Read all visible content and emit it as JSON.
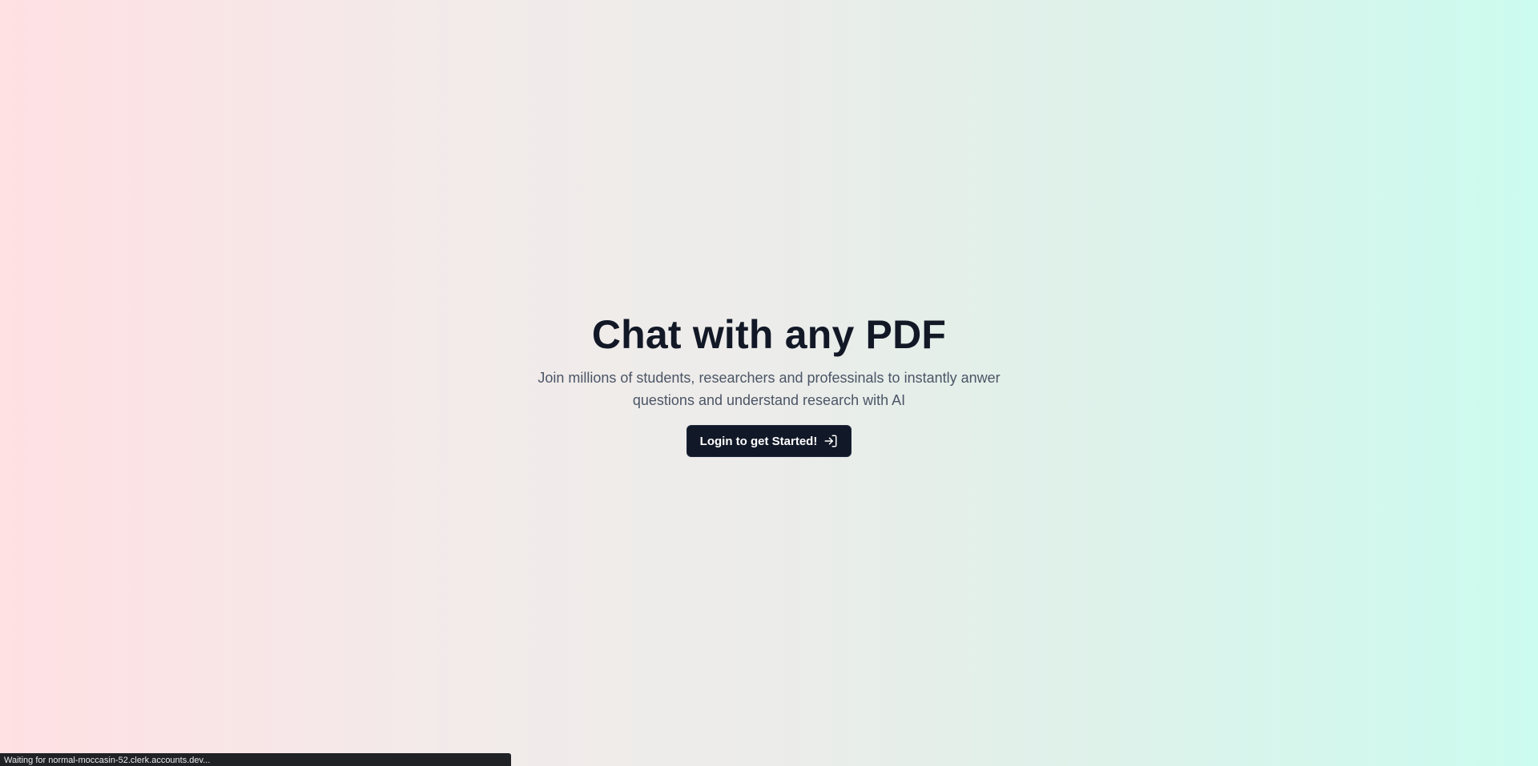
{
  "hero": {
    "title": "Chat with any PDF",
    "subtitle": "Join millions of students, researchers and professinals to instantly anwer questions and understand research with AI",
    "cta_label": "Login to get Started!",
    "cta_icon": "log-in-icon"
  },
  "browser": {
    "status_text": "Waiting for normal-moccasin-52.clerk.accounts.dev..."
  },
  "colors": {
    "gradient_left": "#ffe0e3",
    "gradient_right": "#ccfbef",
    "button_bg": "#111827",
    "title_text": "#121826",
    "subtitle_text": "#4b5565"
  }
}
